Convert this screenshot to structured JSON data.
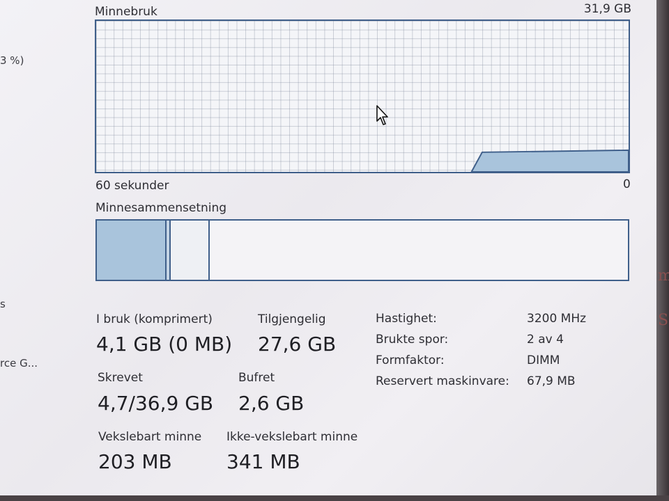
{
  "sidebar": {
    "percent_fragment": "3 %)",
    "s_fragment": "s",
    "gpu_fragment": "rce G..."
  },
  "graph": {
    "title": "Minnebruk",
    "max_label": "31,9 GB",
    "time_label": "60 sekunder",
    "zero_label": "0",
    "usage_fraction": 0.13,
    "stroke_color": "#3f5f8a",
    "fill_color": "#a9c4dc"
  },
  "composition": {
    "title": "Minnesammensetning",
    "accent": "#3f5f8a"
  },
  "stats": {
    "in_use": {
      "label": "I bruk (komprimert)",
      "value": "4,1 GB (0 MB)"
    },
    "available": {
      "label": "Tilgjengelig",
      "value": "27,6 GB"
    },
    "committed": {
      "label": "Skrevet",
      "value": "4,7/36,9 GB"
    },
    "cached": {
      "label": "Bufret",
      "value": "2,6 GB"
    },
    "paged_pool": {
      "label": "Vekslebart minne",
      "value": "203 MB"
    },
    "nonpaged_pool": {
      "label": "Ikke-vekslebart minne",
      "value": "341 MB"
    }
  },
  "details": [
    {
      "label": "Hastighet:",
      "value": "3200 MHz"
    },
    {
      "label": "Brukte spor:",
      "value": "2 av 4"
    },
    {
      "label": "Formfaktor:",
      "value": "DIMM"
    },
    {
      "label": "Reservert maskinvare:",
      "value": "67,9 MB"
    }
  ],
  "edge_glyphs": {
    "upper": "m",
    "lower": "S"
  }
}
